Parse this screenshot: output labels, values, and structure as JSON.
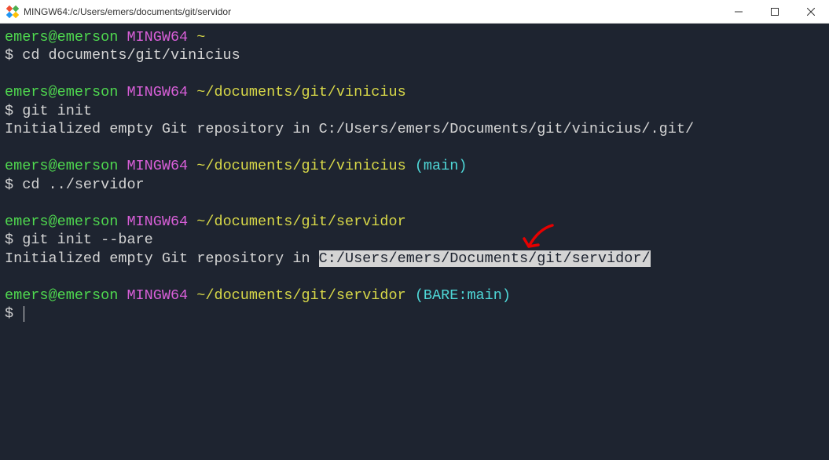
{
  "window": {
    "title": "MINGW64:/c/Users/emers/documents/git/servidor"
  },
  "terminal": {
    "blocks": [
      {
        "user_host": "emers@emerson",
        "mingw": "MINGW64",
        "path": "~",
        "branch": "",
        "command": "cd documents/git/vinicius",
        "output": ""
      },
      {
        "user_host": "emers@emerson",
        "mingw": "MINGW64",
        "path": "~/documents/git/vinicius",
        "branch": "",
        "command": "git init",
        "output": "Initialized empty Git repository in C:/Users/emers/Documents/git/vinicius/.git/"
      },
      {
        "user_host": "emers@emerson",
        "mingw": "MINGW64",
        "path": "~/documents/git/vinicius",
        "branch": "(main)",
        "command": "cd ../servidor",
        "output": ""
      },
      {
        "user_host": "emers@emerson",
        "mingw": "MINGW64",
        "path": "~/documents/git/servidor",
        "branch": "",
        "command": "git init --bare",
        "output_prefix": "Initialized empty Git repository in ",
        "output_highlight": "C:/Users/emers/Documents/git/servidor/"
      },
      {
        "user_host": "emers@emerson",
        "mingw": "MINGW64",
        "path": "~/documents/git/servidor",
        "branch": "(BARE:main)",
        "command": "",
        "output": "",
        "cursor": true
      }
    ],
    "prompt_symbol": "$"
  }
}
